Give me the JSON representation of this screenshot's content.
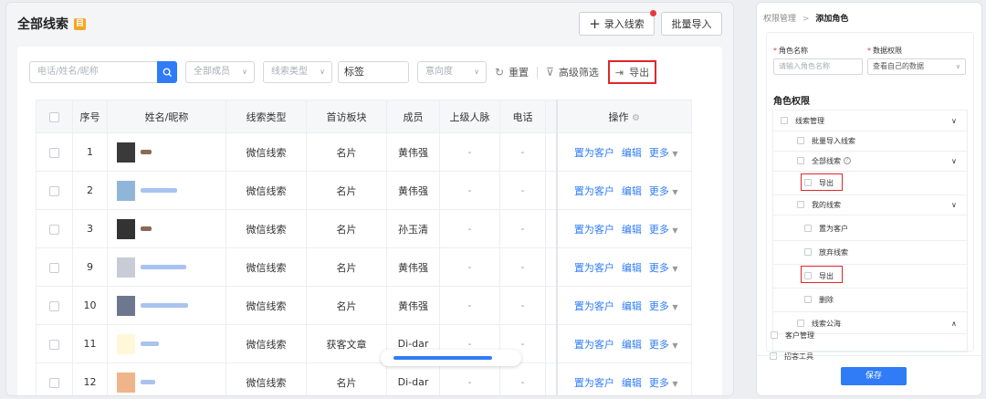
{
  "header": {
    "title": "全部线索",
    "title_badge": "目",
    "add_button": "录入线索",
    "import_button": "批量导入"
  },
  "filters": {
    "search_placeholder": "电话/姓名/昵称",
    "member_placeholder": "全部成员",
    "type_placeholder": "线索类型",
    "tag_value": "标签",
    "intent_placeholder": "意向度",
    "reset": "重置",
    "advanced": "高级筛选",
    "export": "导出"
  },
  "table": {
    "headers": {
      "index": "序号",
      "name": "姓名/昵称",
      "type": "线索类型",
      "module": "首访板块",
      "member": "成员",
      "upline": "上级人脉",
      "phone": "电话",
      "ops": "操作"
    },
    "actions": {
      "to_customer": "置为客户",
      "edit": "编辑",
      "more": "更多"
    },
    "rows": [
      {
        "index": "1",
        "type": "微信线索",
        "module": "名片",
        "member": "黄伟强",
        "upline": "-",
        "phone": "-"
      },
      {
        "index": "2",
        "type": "微信线索",
        "module": "名片",
        "member": "黄伟强",
        "upline": "-",
        "phone": "-"
      },
      {
        "index": "3",
        "type": "微信线索",
        "module": "名片",
        "member": "孙玉清",
        "upline": "-",
        "phone": "-"
      },
      {
        "index": "9",
        "type": "微信线索",
        "module": "名片",
        "member": "黄伟强",
        "upline": "-",
        "phone": "-"
      },
      {
        "index": "10",
        "type": "微信线索",
        "module": "名片",
        "member": "黄伟强",
        "upline": "-",
        "phone": "-"
      },
      {
        "index": "11",
        "type": "微信线索",
        "module": "获客文章",
        "member": "Di-dar",
        "upline": "-",
        "phone": "-"
      },
      {
        "index": "12",
        "type": "微信线索",
        "module": "名片",
        "member": "Di-dar",
        "upline": "-",
        "phone": "-"
      }
    ]
  },
  "right_panel": {
    "breadcrumb_parent": "权限管理",
    "breadcrumb_current": "添加角色",
    "role_name_label": "角色名称",
    "role_name_placeholder": "请输入角色名称",
    "data_perm_label": "数据权限",
    "data_perm_value": "查看自己的数据",
    "section_title": "角色权限",
    "tree": {
      "clue_mgmt": "线索管理",
      "batch_import": "批量导入线索",
      "all_clues": "全部线索",
      "export_1": "导出",
      "my_clues": "我的线索",
      "to_customer": "置为客户",
      "abandon": "放弃线索",
      "export_2": "导出",
      "delete": "删除",
      "clue_pool": "线索公海",
      "customer_mgmt": "客户管理",
      "acquire_tools": "招客工具"
    },
    "save": "保存"
  },
  "colors": {
    "accent": "#2f7cf6",
    "highlight": "#e0262c"
  }
}
